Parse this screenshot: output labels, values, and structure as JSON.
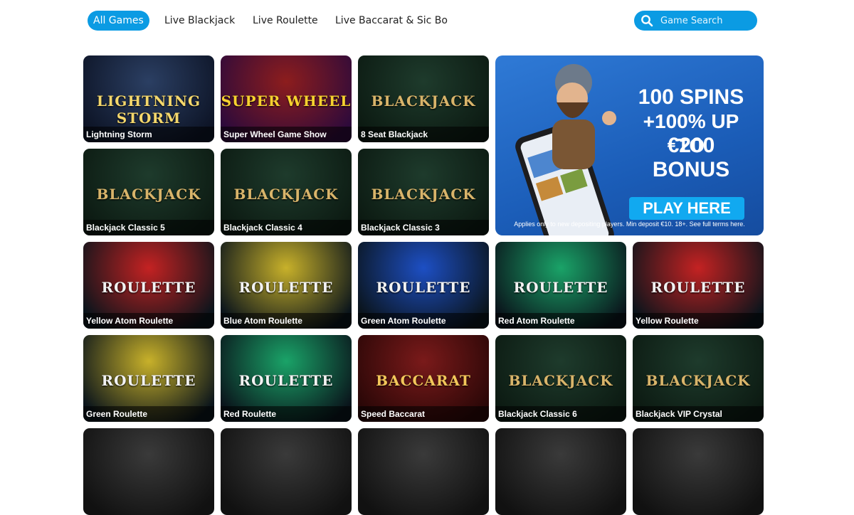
{
  "nav": {
    "tabs": [
      {
        "label": "All Games",
        "active": true
      },
      {
        "label": "Live Blackjack",
        "active": false
      },
      {
        "label": "Live Roulette",
        "active": false
      },
      {
        "label": "Live Baccarat & Sic Bo",
        "active": false
      }
    ],
    "search": {
      "placeholder": "Game Search",
      "icon": "search-icon"
    }
  },
  "games": [
    {
      "name": "Lightning Storm",
      "art": "LIGHTNING STORM"
    },
    {
      "name": "Super Wheel Game Show",
      "art": "SUPER WHEEL"
    },
    {
      "name": "8 Seat Blackjack",
      "art": "BLACKJACK"
    },
    {
      "name": "Blackjack Classic 5",
      "art": "BLACKJACK"
    },
    {
      "name": "Blackjack Classic 4",
      "art": "BLACKJACK"
    },
    {
      "name": "Blackjack Classic 3",
      "art": "BLACKJACK"
    },
    {
      "name": "Yellow Atom Roulette",
      "art": "ROULETTE"
    },
    {
      "name": "Blue Atom Roulette",
      "art": "ROULETTE"
    },
    {
      "name": "Green Atom Roulette",
      "art": "ROULETTE"
    },
    {
      "name": "Red Atom Roulette",
      "art": "ROULETTE"
    },
    {
      "name": "Yellow Roulette",
      "art": "ROULETTE"
    },
    {
      "name": "Green Roulette",
      "art": "ROULETTE"
    },
    {
      "name": "Red Roulette",
      "art": "ROULETTE"
    },
    {
      "name": "Speed Baccarat",
      "art": "BACCARAT"
    },
    {
      "name": "Blackjack Classic 6",
      "art": "BLACKJACK"
    },
    {
      "name": "Blackjack VIP Crystal",
      "art": "BLACKJACK"
    },
    {
      "name": "",
      "art": ""
    },
    {
      "name": "",
      "art": ""
    },
    {
      "name": "",
      "art": ""
    },
    {
      "name": "",
      "art": ""
    },
    {
      "name": "",
      "art": ""
    }
  ],
  "promo": {
    "line1": "100 SPINS",
    "line2": "+100% UP TO",
    "line3": "€200",
    "line4": "BONUS",
    "button": "PLAY HERE",
    "terms": "Applies only to new depositing players. Min deposit €10. 18+. See full terms here."
  },
  "colors": {
    "accent": "#0b9be3",
    "promo_bg": "#1b5db8"
  }
}
